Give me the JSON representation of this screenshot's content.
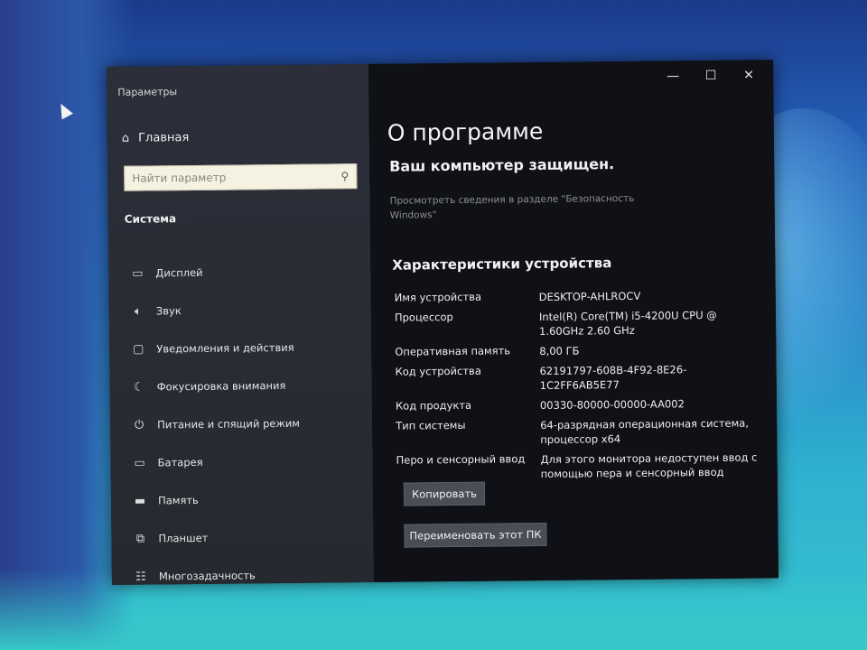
{
  "window": {
    "title": "Параметры",
    "controls": {
      "minimize": "—",
      "maximize": "☐",
      "close": "✕"
    }
  },
  "sidebar": {
    "home_label": "Главная",
    "search_placeholder": "Найти параметр",
    "section": "Система",
    "items": [
      {
        "label": "Дисплей",
        "icon": "display-icon"
      },
      {
        "label": "Звук",
        "icon": "sound-icon"
      },
      {
        "label": "Уведомления и действия",
        "icon": "notifications-icon"
      },
      {
        "label": "Фокусировка внимания",
        "icon": "focus-assist-icon"
      },
      {
        "label": "Питание и спящий режим",
        "icon": "power-icon"
      },
      {
        "label": "Батарея",
        "icon": "battery-icon"
      },
      {
        "label": "Память",
        "icon": "storage-icon"
      },
      {
        "label": "Планшет",
        "icon": "tablet-icon"
      },
      {
        "label": "Многозадачность",
        "icon": "multitasking-icon"
      }
    ]
  },
  "content": {
    "page_title": "О программе",
    "protection_title": "Ваш компьютер защищен.",
    "protection_link": "Просмотреть сведения в разделе \"Безопасность Windows\"",
    "specs_title": "Характеристики устройства",
    "specs": [
      {
        "label": "Имя устройства",
        "value": "DESKTOP-AHLROCV"
      },
      {
        "label": "Процессор",
        "value": "Intel(R) Core(TM) i5-4200U CPU @ 1.60GHz   2.60 GHz"
      },
      {
        "label": "Оперативная память",
        "value": "8,00 ГБ"
      },
      {
        "label": "Код устройства",
        "value": "62191797-608B-4F92-8E26-1C2FF6AB5E77"
      },
      {
        "label": "Код продукта",
        "value": "00330-80000-00000-AA002"
      },
      {
        "label": "Тип системы",
        "value": "64-разрядная операционная система, процессор x64"
      },
      {
        "label": "Перо и сенсорный ввод",
        "value": "Для этого монитора недоступен ввод с помощью пера и сенсорный ввод"
      }
    ],
    "copy_button": "Копировать",
    "rename_button": "Переименовать этот ПК"
  }
}
